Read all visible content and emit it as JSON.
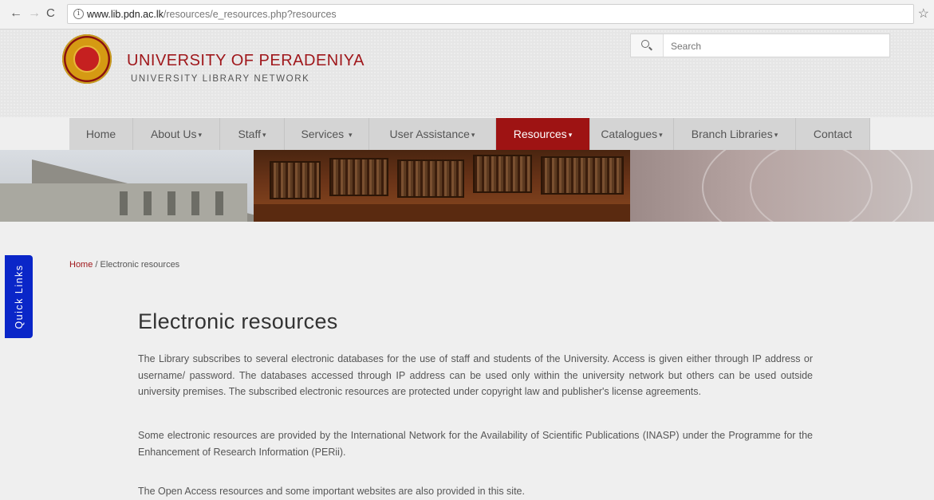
{
  "browser": {
    "back_icon": "←",
    "forward_icon": "→",
    "reload_icon": "C",
    "url_host": "www.lib.pdn.ac.lk",
    "url_path": "/resources/e_resources.php?resources",
    "info_icon": "i",
    "star_icon": "☆"
  },
  "header": {
    "university_name": "UNIVERSITY OF PERADENIYA",
    "subtitle": "UNIVERSITY LIBRARY NETWORK",
    "search_placeholder": "Search"
  },
  "nav": {
    "items": [
      {
        "label": "Home",
        "dropdown": false
      },
      {
        "label": "About Us",
        "dropdown": true
      },
      {
        "label": "Staff",
        "dropdown": true
      },
      {
        "label": "Services",
        "dropdown": true
      },
      {
        "label": "User Assistance",
        "dropdown": true
      },
      {
        "label": "Resources",
        "dropdown": true,
        "active": true
      },
      {
        "label": "Catalogues",
        "dropdown": true
      },
      {
        "label": "Branch Libraries",
        "dropdown": true
      },
      {
        "label": "Contact",
        "dropdown": false
      }
    ],
    "caret": "▾"
  },
  "quick_links": {
    "label": "Quick Links"
  },
  "breadcrumb": {
    "home": "Home",
    "separator": "/",
    "current": "Electronic resources"
  },
  "content": {
    "title": "Electronic resources",
    "paragraphs": [
      "The Library subscribes to several electronic databases for the use of staff and students of the University. Access is given either through IP address or username/ password.  The databases accessed through IP address can be used only within the university network but others can be used outside university premises. The subscribed electronic resources are protected under copyright law and publisher's license agreements.",
      "Some electronic resources are provided by the International Network for the Availability of Scientific  Publications (INASP) under the Programme for the Enhancement of Research Information (PERii).",
      "The Open Access resources and some important websites are also provided in this site."
    ]
  },
  "colors": {
    "brand_red": "#9e1313",
    "quick_links_blue": "#0a26c8",
    "nav_bg": "#d4d4d4"
  }
}
